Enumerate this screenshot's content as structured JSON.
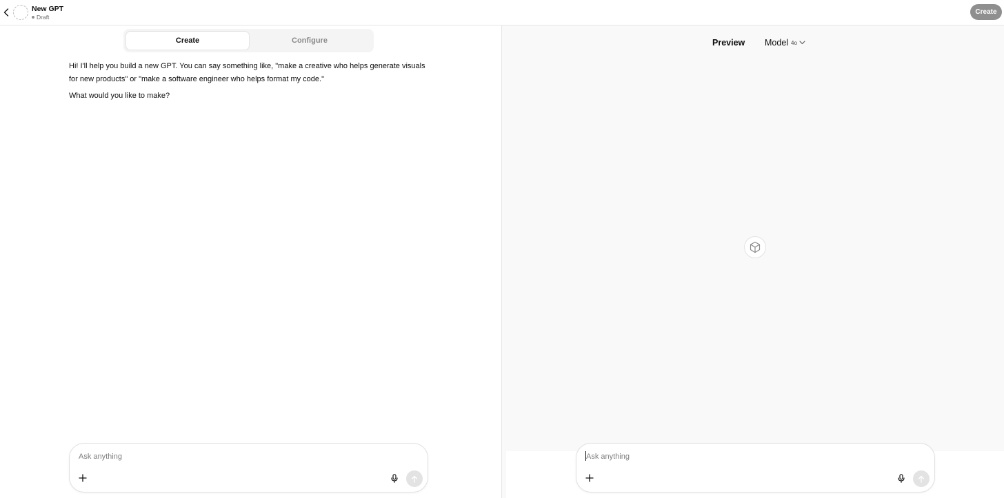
{
  "header": {
    "gpt_name": "New GPT",
    "status": "Draft",
    "create_button": "Create"
  },
  "builder": {
    "tabs": [
      {
        "label": "Create",
        "active": true
      },
      {
        "label": "Configure",
        "active": false
      }
    ],
    "messages": [
      "Hi! I'll help you build a new GPT. You can say something like, \"make a creative who helps generate visuals for new products\" or \"make a software engineer who helps format my code.\"",
      "What would you like to make?"
    ],
    "composer": {
      "placeholder": "Ask anything",
      "value": ""
    }
  },
  "preview": {
    "title": "Preview",
    "model_label": "Model",
    "model_version": "4o",
    "composer": {
      "placeholder": "Ask anything",
      "value": ""
    }
  },
  "icons": {
    "back": "chevron-left-icon",
    "avatar": "dashed-circle-avatar",
    "model_dropdown": "chevron-down-icon",
    "gpt_placeholder": "cube-icon",
    "attach": "plus-icon",
    "voice": "microphone-icon",
    "send": "arrow-up-icon"
  },
  "colors": {
    "create_button_bg": "#8f8f8f",
    "preview_bg": "#f9f9f9",
    "tab_inactive_text": "#8a8a8a"
  }
}
